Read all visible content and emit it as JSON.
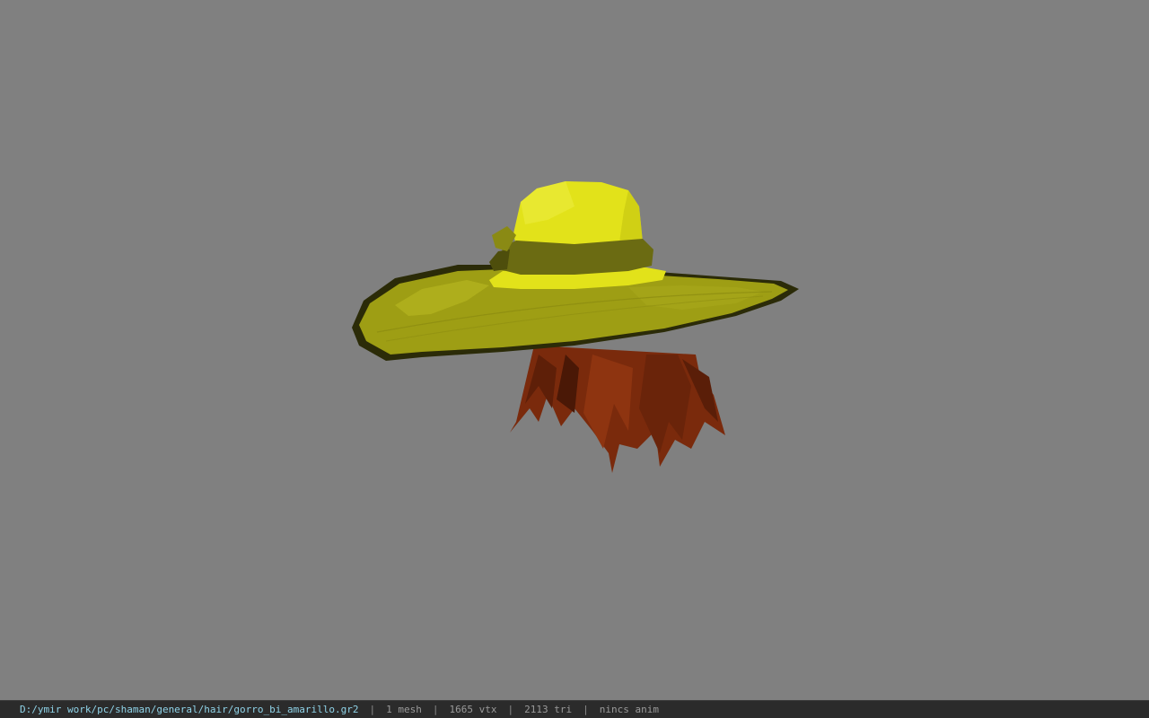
{
  "viewer": {
    "background_color": "#808080",
    "model": {
      "name": "hat-with-hair",
      "colors": {
        "hat_crown": "#e2e21a",
        "hat_band": "#6b6b12",
        "hat_brim": "#9e9e14",
        "brim_edge": "#2b2b08",
        "hair": "#7a2a0c"
      }
    }
  },
  "statusbar": {
    "file_path": "D:/ymir work/pc/shaman/general/hair/gorro_bi_amarillo.gr2",
    "separator": "|",
    "mesh_count": "1 mesh",
    "vertex_count": "1665 vtx",
    "triangle_count": "2113 tri",
    "animation": "nincs anim"
  }
}
